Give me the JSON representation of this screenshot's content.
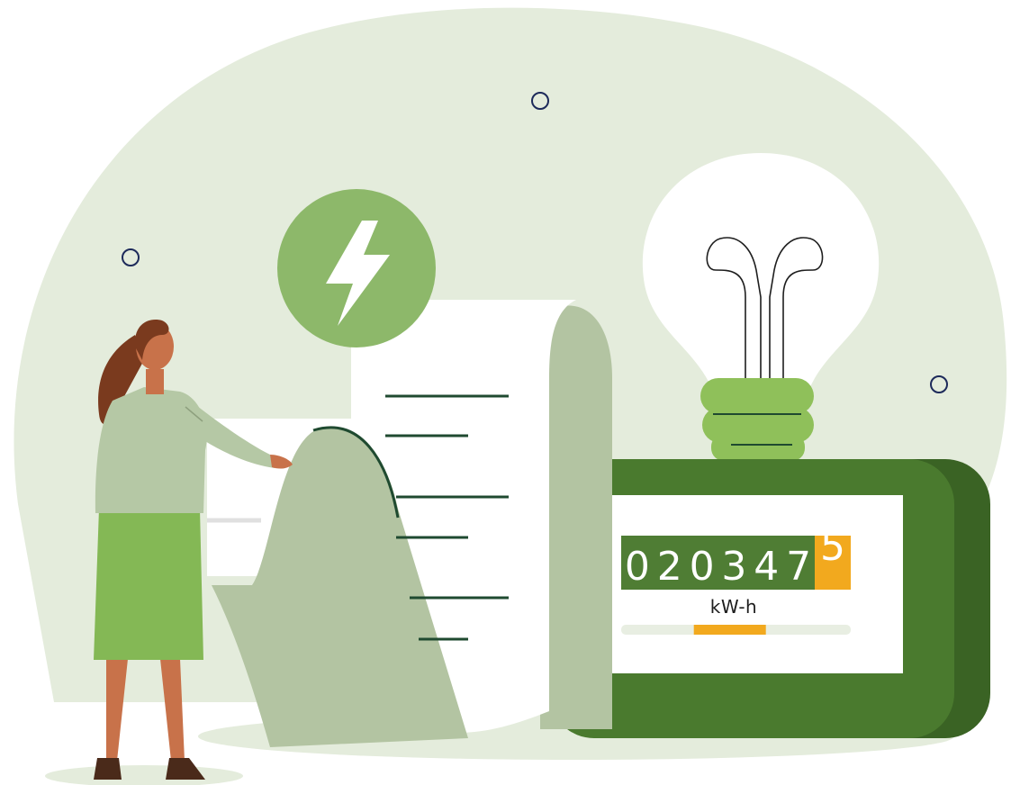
{
  "meter": {
    "reading_digits": [
      "0",
      "2",
      "0",
      "3",
      "4",
      "7"
    ],
    "rolling_digit": "5",
    "unit": "kW-h",
    "progress": 0.34
  },
  "colors": {
    "background_blob": "#e4ecdc",
    "meter_body": "#4a7a2e",
    "meter_shadow": "#3a6324",
    "digit_panel": "#4f7d34",
    "accent_orange": "#f2a91e",
    "lightning_circle": "#8db86a",
    "paper_shadow": "#b3c4a2",
    "bulb_base": "#8fc05a",
    "ring_stroke": "#1d2a5a",
    "line_dark": "#1f4a30",
    "skirt": "#84b855",
    "sweater": "#b5c8a5",
    "skin": "#c8724a",
    "hair": "#7a3a1e"
  },
  "icons": [
    "lightning-bolt-icon",
    "light-bulb-icon",
    "energy-meter-icon"
  ]
}
